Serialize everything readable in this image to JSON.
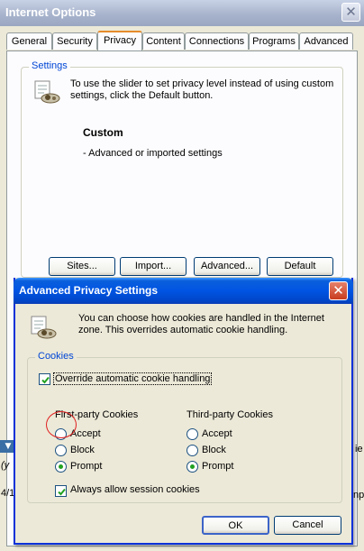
{
  "main_window": {
    "title": "Internet Options",
    "close_glyph": "✕",
    "tabs": [
      {
        "label": "General"
      },
      {
        "label": "Security"
      },
      {
        "label": "Privacy"
      },
      {
        "label": "Content"
      },
      {
        "label": "Connections"
      },
      {
        "label": "Programs"
      },
      {
        "label": "Advanced"
      }
    ],
    "active_tab": "Privacy",
    "settings_group": {
      "label": "Settings",
      "info_line1": "To use the slider to set privacy level instead of using custom",
      "info_line2": "settings, click the Default button.",
      "level_title": "Custom",
      "level_desc": "- Advanced or imported settings",
      "icon": "privacy-settings-icon"
    },
    "buttons": {
      "sites": "Sites...",
      "import": "Import...",
      "advanced": "Advanced...",
      "default": "Default"
    },
    "background_fragments": {
      "frag_a": "(y",
      "frag_b": "4/1",
      "frag_c": "ie",
      "frag_d": "np"
    }
  },
  "dialog": {
    "title": "Advanced Privacy Settings",
    "close_glyph": "✕",
    "info_line1": "You can choose how cookies are handled in the Internet",
    "info_line2": "zone.  This overrides automatic cookie handling.",
    "cookies_group": {
      "label": "Cookies",
      "override_label": "Override automatic cookie handling",
      "override_checked": true,
      "first_party": {
        "header": "First-party Cookies",
        "options": [
          "Accept",
          "Block",
          "Prompt"
        ],
        "selected": "Prompt"
      },
      "third_party": {
        "header": "Third-party Cookies",
        "options": [
          "Accept",
          "Block",
          "Prompt"
        ],
        "selected": "Prompt"
      },
      "session_label": "Always allow session cookies",
      "session_checked": true
    },
    "buttons": {
      "ok": "OK",
      "cancel": "Cancel"
    },
    "annotation_color": "#e02020"
  }
}
